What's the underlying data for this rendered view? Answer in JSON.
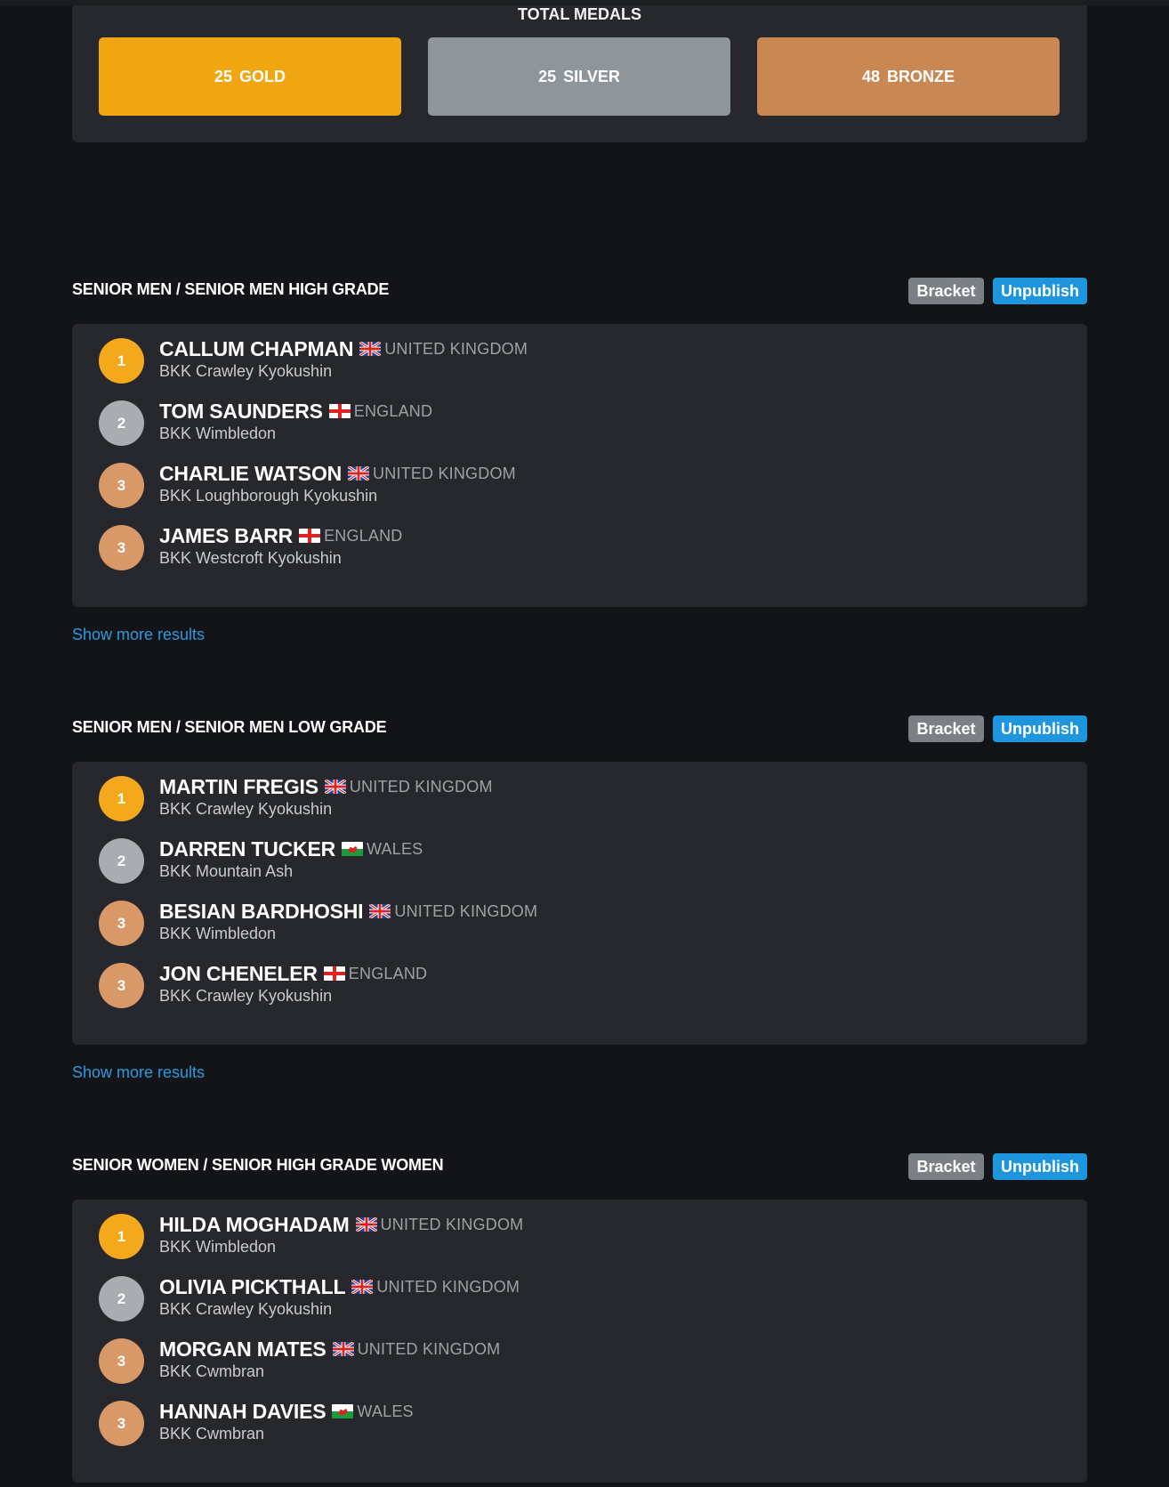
{
  "total_medals": {
    "title": "TOTAL MEDALS",
    "gold": {
      "count": "25",
      "label": "GOLD"
    },
    "silver": {
      "count": "25",
      "label": "SILVER"
    },
    "bronze": {
      "count": "48",
      "label": "BRONZE"
    }
  },
  "buttons": {
    "bracket": "Bracket",
    "unpublish": "Unpublish",
    "show_more": "Show more results"
  },
  "colors": {
    "gold": "#f0a611",
    "silver": "#8f969b",
    "bronze": "#c98853",
    "accent": "#1f95dd",
    "background": "#131417",
    "panel": "#27282d"
  },
  "sections": [
    {
      "title": "SENIOR MEN / SENIOR MEN HIGH GRADE",
      "results": [
        {
          "place": "1",
          "name": "CALLUM CHAPMAN",
          "flag": "uk-flag-icon",
          "country": "UNITED KINGDOM",
          "club": "BKK Crawley Kyokushin"
        },
        {
          "place": "2",
          "name": "TOM SAUNDERS",
          "flag": "england-flag-icon",
          "country": "ENGLAND",
          "club": "BKK Wimbledon"
        },
        {
          "place": "3",
          "name": "CHARLIE WATSON",
          "flag": "uk-flag-icon",
          "country": "UNITED KINGDOM",
          "club": "BKK Loughborough Kyokushin"
        },
        {
          "place": "3",
          "name": "JAMES BARR",
          "flag": "england-flag-icon",
          "country": "ENGLAND",
          "club": "BKK Westcroft Kyokushin"
        }
      ]
    },
    {
      "title": "SENIOR MEN / SENIOR MEN LOW GRADE",
      "results": [
        {
          "place": "1",
          "name": "MARTIN FREGIS",
          "flag": "uk-flag-icon",
          "country": "UNITED KINGDOM",
          "club": "BKK Crawley Kyokushin"
        },
        {
          "place": "2",
          "name": "DARREN TUCKER",
          "flag": "wales-flag-icon",
          "country": "WALES",
          "club": "BKK Mountain Ash"
        },
        {
          "place": "3",
          "name": "BESIAN BARDHOSHI",
          "flag": "uk-flag-icon",
          "country": "UNITED KINGDOM",
          "club": "BKK Wimbledon"
        },
        {
          "place": "3",
          "name": "JON CHENELER",
          "flag": "england-flag-icon",
          "country": "ENGLAND",
          "club": "BKK Crawley Kyokushin"
        }
      ]
    },
    {
      "title": "SENIOR WOMEN / SENIOR HIGH GRADE WOMEN",
      "results": [
        {
          "place": "1",
          "name": "HILDA MOGHADAM",
          "flag": "uk-flag-icon",
          "country": "UNITED KINGDOM",
          "club": "BKK Wimbledon"
        },
        {
          "place": "2",
          "name": "OLIVIA PICKTHALL",
          "flag": "uk-flag-icon",
          "country": "UNITED KINGDOM",
          "club": "BKK Crawley Kyokushin"
        },
        {
          "place": "3",
          "name": "MORGAN MATES",
          "flag": "uk-flag-icon",
          "country": "UNITED KINGDOM",
          "club": "BKK Cwmbran"
        },
        {
          "place": "3",
          "name": "HANNAH DAVIES",
          "flag": "wales-flag-icon",
          "country": "WALES",
          "club": "BKK Cwmbran"
        }
      ]
    }
  ]
}
